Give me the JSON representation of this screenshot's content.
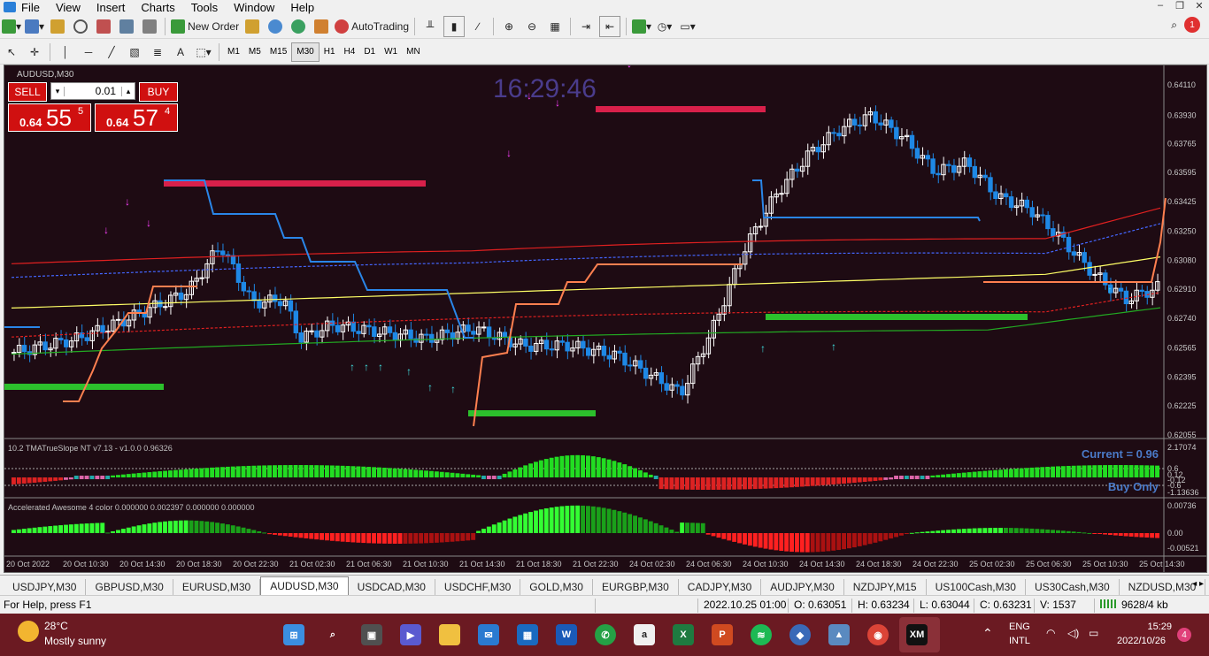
{
  "menu": {
    "items": [
      "File",
      "View",
      "Insert",
      "Charts",
      "Tools",
      "Window",
      "Help"
    ]
  },
  "toolbar": {
    "new_order_label": "New Order",
    "autotrading_label": "AutoTrading",
    "timeframes": [
      "M1",
      "M5",
      "M15",
      "M30",
      "H1",
      "H4",
      "D1",
      "W1",
      "MN"
    ],
    "active_timeframe": "M30",
    "notification_count": "1"
  },
  "chart": {
    "title": "AUDUSD,M30",
    "clock": "16:29:46",
    "trade_panel": {
      "sell_label": "SELL",
      "buy_label": "BUY",
      "lot": "0.01",
      "sell_small": "0.64",
      "sell_big": "55",
      "sell_sup": "5",
      "buy_small": "0.64",
      "buy_big": "57",
      "buy_sup": "4"
    },
    "price_axis": [
      "0.64110",
      "0.63930",
      "0.63765",
      "0.63595",
      "0.63425",
      "0.63250",
      "0.63080",
      "0.62910",
      "0.62740",
      "0.62565",
      "0.62395",
      "0.62225",
      "0.62055"
    ],
    "indicator1": {
      "title": "10.2 TMATrueSlope NT v7.13  -  v1.0.0    0.96326",
      "current_label": "Current = 0.96",
      "signal_label": "Buy Only",
      "axis": [
        "2.17074",
        "0.6",
        "0.12",
        "-0.12",
        "-0.6",
        "-1.13636"
      ]
    },
    "indicator2": {
      "title": "Accelerated Awesome 4 color 0.000000 0.002397 0.000000 0.000000",
      "axis": [
        "0.00736",
        "0.00",
        "-0.00521"
      ]
    },
    "time_axis": [
      "20 Oct 2022",
      "20 Oct 10:30",
      "20 Oct 14:30",
      "20 Oct 18:30",
      "20 Oct 22:30",
      "21 Oct 02:30",
      "21 Oct 06:30",
      "21 Oct 10:30",
      "21 Oct 14:30",
      "21 Oct 18:30",
      "21 Oct 22:30",
      "24 Oct 02:30",
      "24 Oct 06:30",
      "24 Oct 10:30",
      "24 Oct 14:30",
      "24 Oct 18:30",
      "24 Oct 22:30",
      "25 Oct 02:30",
      "25 Oct 06:30",
      "25 Oct 10:30",
      "25 Oct 14:30"
    ],
    "colors": {
      "background": "#1e0b13",
      "bull": "#ffffff",
      "bear": "#1e88e5",
      "ma_red": "#e02020",
      "ma_yellow": "#ffff66",
      "ma_green": "#22aa22"
    }
  },
  "tabs": [
    "USDJPY,M30",
    "GBPUSD,M30",
    "EURUSD,M30",
    "AUDUSD,M30",
    "USDCAD,M30",
    "USDCHF,M30",
    "GOLD,M30",
    "EURGBP,M30",
    "CADJPY,M30",
    "AUDJPY,M30",
    "NZDJPY,M15",
    "US100Cash,M30",
    "US30Cash,M30",
    "NZDUSD,M30"
  ],
  "active_tab": "AUDUSD,M30",
  "status": {
    "help": "For Help, press F1",
    "datetime": "2022.10.25 01:00",
    "open": "O: 0.63051",
    "high": "H: 0.63234",
    "low": "L: 0.63044",
    "close": "C: 0.63231",
    "volume": "V: 1537",
    "traffic": "9628/4 kb"
  },
  "taskbar": {
    "weather_temp": "28°C",
    "weather_desc": "Mostly sunny",
    "lang1": "ENG",
    "lang2": "INTL",
    "time": "15:29",
    "date": "2022/10/26",
    "notifications": "4"
  }
}
